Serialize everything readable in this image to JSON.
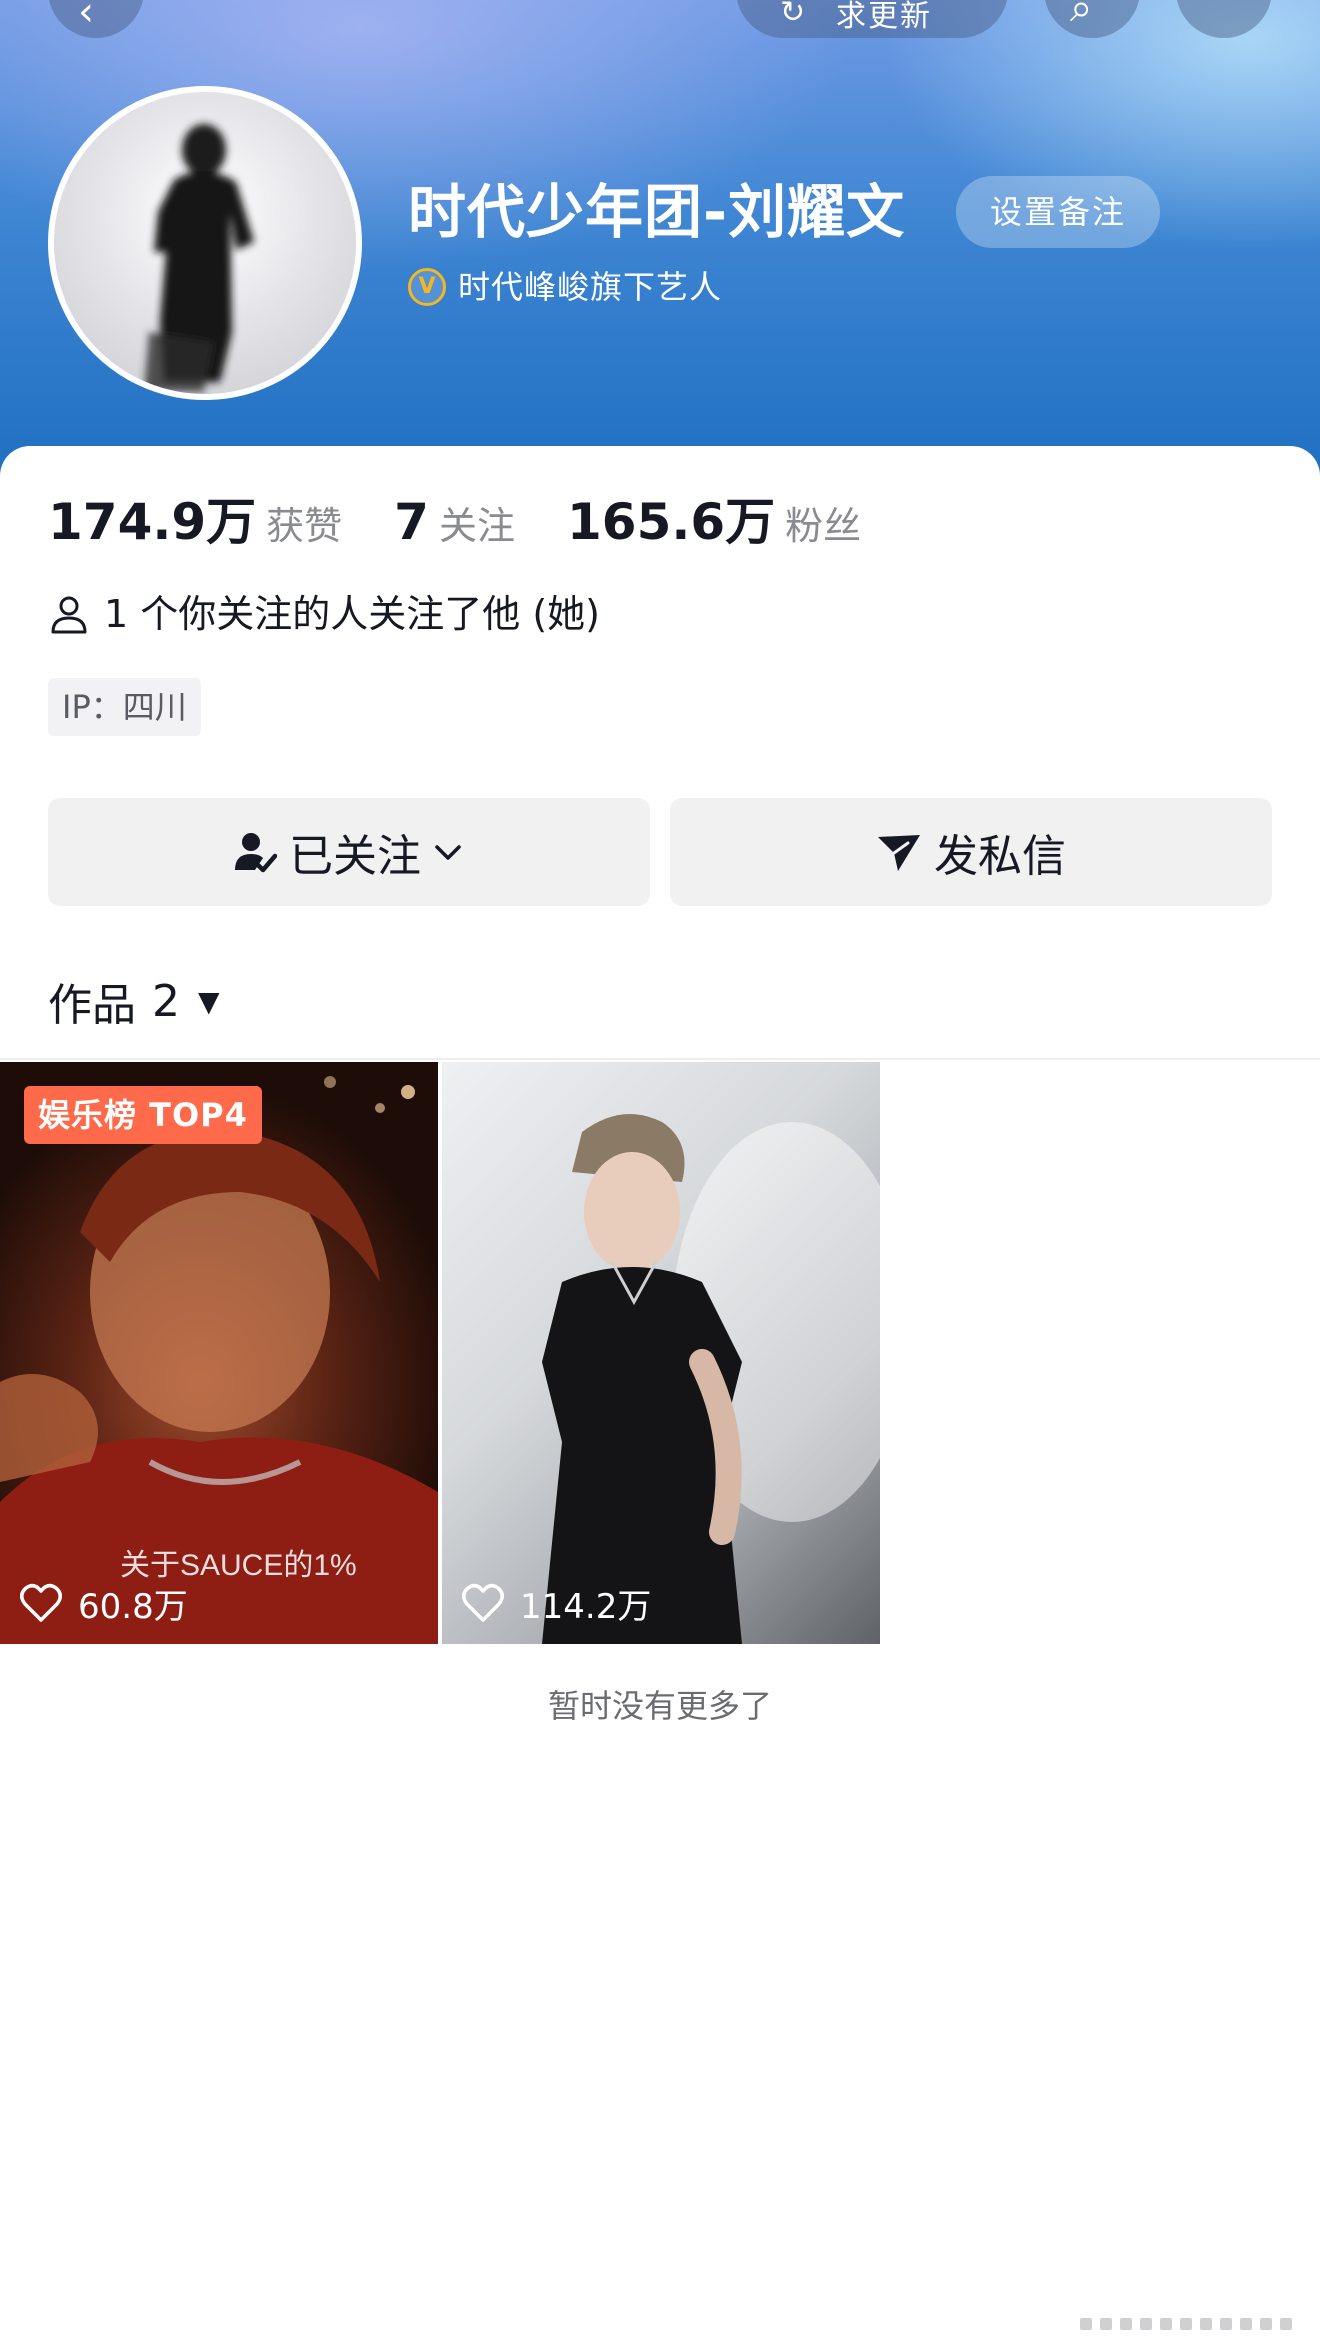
{
  "header": {
    "update_label": "求更新",
    "nickname": "时代少年团-刘耀文",
    "remark_label": "设置备注",
    "verify_badge": "V",
    "verify_text": "时代峰峻旗下艺人"
  },
  "stats": [
    {
      "value": "174.9万",
      "label": "获赞"
    },
    {
      "value": "7",
      "label": "关注"
    },
    {
      "value": "165.6万",
      "label": "粉丝"
    }
  ],
  "mutual_follow": "1 个你关注的人关注了他 (她)",
  "ip_location": "IP：四川",
  "actions": {
    "follow_label": "已关注",
    "message_label": "发私信"
  },
  "works_tab": {
    "label": "作品",
    "count": "2"
  },
  "videos": [
    {
      "badge": "娱乐榜 TOP4",
      "caption": "关于SAUCE的1%",
      "likes": "60.8万"
    },
    {
      "likes": "114.2万"
    }
  ],
  "footer": {
    "no_more": "暂时没有更多了"
  },
  "colors": {
    "badge": "#fe6a4a",
    "verify": "#f5b623",
    "banner_blue": "#2f7cd0"
  }
}
